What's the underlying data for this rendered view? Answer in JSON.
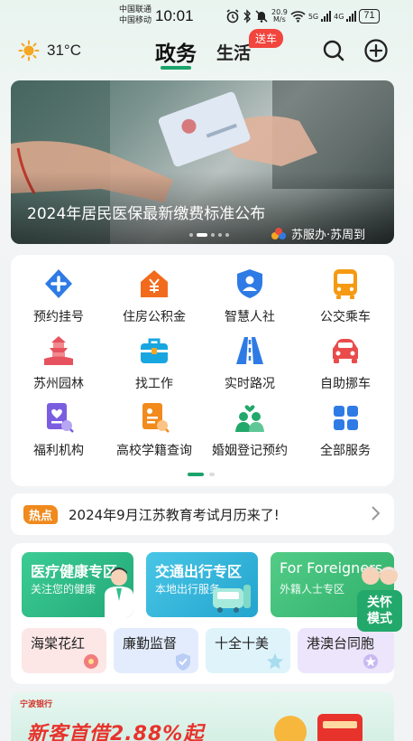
{
  "status_bar": {
    "carrier_1": "中国联通",
    "carrier_2": "中国移动",
    "time": "10:01",
    "net_speed": "20.9",
    "net_unit": "M/s",
    "net_1": "5G",
    "net_2": "4G",
    "battery": "71"
  },
  "header": {
    "temperature": "31°C",
    "tab_active": "政务",
    "tab_other": "生活",
    "tab_other_badge": "送车"
  },
  "banner": {
    "title": "2024年居民医保最新缴费标准公布",
    "source": "苏服办·苏周到",
    "dots_total": 5,
    "dots_active_index": 1
  },
  "services": [
    {
      "label": "预约挂号",
      "icon": "plus-cross-icon",
      "color": "#2f7be5"
    },
    {
      "label": "住房公积金",
      "icon": "house-yuan-icon",
      "color": "#f26b1d"
    },
    {
      "label": "智慧人社",
      "icon": "shield-person-icon",
      "color": "#2f7be5"
    },
    {
      "label": "公交乘车",
      "icon": "bus-icon",
      "color": "#f59a12"
    },
    {
      "label": "苏州园林",
      "icon": "pagoda-icon",
      "color": "#e6525d"
    },
    {
      "label": "找工作",
      "icon": "briefcase-icon",
      "color": "#18a6e0"
    },
    {
      "label": "实时路况",
      "icon": "road-icon",
      "color": "#2f7be5"
    },
    {
      "label": "自助挪车",
      "icon": "car-icon",
      "color": "#ea4b4b"
    },
    {
      "label": "福利机构",
      "icon": "heart-document-icon",
      "color": "#7b5de0"
    },
    {
      "label": "高校学籍查询",
      "icon": "search-document-icon",
      "color": "#f28a1c"
    },
    {
      "label": "婚姻登记预约",
      "icon": "couple-heart-icon",
      "color": "#22a86a"
    },
    {
      "label": "全部服务",
      "icon": "grid-icon",
      "color": "#2f7be5"
    }
  ],
  "news": {
    "tag": "热点",
    "text": "2024年9月江苏教育考试月历来了!"
  },
  "zones": [
    {
      "title": "医疗健康专区",
      "subtitle": "关注您的健康",
      "color": "#2fc08b"
    },
    {
      "title": "交通出行专区",
      "subtitle": "本地出行服务",
      "color": "#35b5d8"
    },
    {
      "title": "For Foreigners",
      "subtitle": "外籍人士专区",
      "color": "#45c47d"
    }
  ],
  "chips": [
    {
      "label": "海棠花红",
      "color": "#fde6e6"
    },
    {
      "label": "廉勤监督",
      "color": "#e3ecfc"
    },
    {
      "label": "十全十美",
      "color": "#dff3fb"
    },
    {
      "label": "港澳台同胞",
      "color": "#ece5fb"
    }
  ],
  "care_mode": {
    "line1": "关怀",
    "line2": "模式"
  },
  "ad": {
    "logo": "宁波银行",
    "text": "新客首借2.88%起"
  }
}
